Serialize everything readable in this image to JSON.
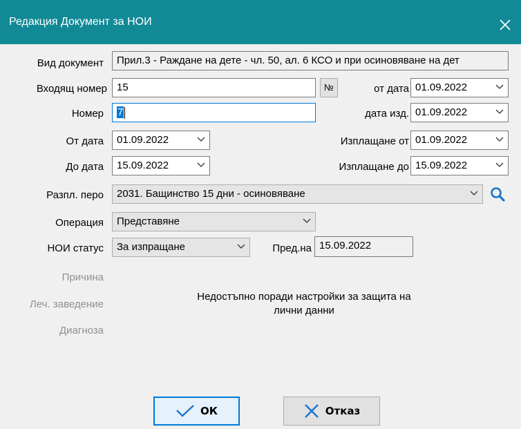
{
  "window": {
    "title": "Редакция Документ за НОИ"
  },
  "form": {
    "doc_type_label": "Вид документ",
    "doc_type_value": "Прил.3 - Раждане на дете - чл. 50, ал. 6 КСО и при осиновяване на дет",
    "incoming_label": "Входящ номер",
    "incoming_value": "15",
    "number_btn": "№",
    "from_date_label": "от дата",
    "from_date_value": "01.09.2022",
    "number_label": "Номер",
    "number_value": "7",
    "issue_date_label": "дата изд.",
    "issue_date_value": "01.09.2022",
    "period_from_label": "От дата",
    "period_from_value": "01.09.2022",
    "pay_from_label": "Изплащане от",
    "pay_from_value": "01.09.2022",
    "period_to_label": "До дата",
    "period_to_value": "15.09.2022",
    "pay_to_label": "Изплащане до",
    "pay_to_value": "15.09.2022",
    "pay_item_label": "Разпл. перо",
    "pay_item_value": "2031. Бащинство 15 дни - осиновяване",
    "operation_label": "Операция",
    "operation_value": "Представяне",
    "noi_status_label": "НОИ статус",
    "noi_status_value": "За изпращане",
    "submitted_label": "Пред.на",
    "submitted_value": "15.09.2022",
    "reason_label": "Причина",
    "facility_label": "Леч. заведение",
    "diagnosis_label": "Диагноза",
    "notice": "Недостъпно поради настройки за защита на лични данни"
  },
  "buttons": {
    "ok": "ОК",
    "cancel": "Отказ"
  },
  "colors": {
    "titlebar": "#118a96",
    "accent": "#0078d7",
    "search_icon": "#1c73c9"
  }
}
